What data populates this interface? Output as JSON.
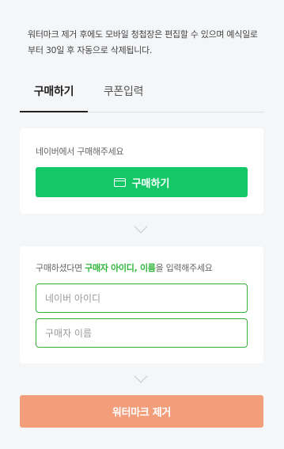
{
  "notice": "워터마크 제거 후에도 모바일 청첩장은 편집할 수 있으며 예식일로부터 30일 후 자동으로 삭제됩니다.",
  "tabs": [
    {
      "label": "구매하기",
      "active": true
    },
    {
      "label": "쿠폰입력",
      "active": false
    }
  ],
  "purchase": {
    "label": "네이버에서 구매해주세요",
    "button_label": "구매하기",
    "button_icon": "credit-card-icon",
    "button_color": "#14c867"
  },
  "verify": {
    "label_prefix": "구매하셨다면 ",
    "label_highlight": "구매자 아이디, 이름",
    "label_suffix": "을 입력해주세요",
    "highlight_color": "#2fb53a",
    "id_placeholder": "네이버 아이디",
    "id_value": "",
    "name_placeholder": "구매자 이름",
    "name_value": ""
  },
  "chevron_icon": "chevron-down-icon",
  "remove_button": {
    "label": "워터마크 제거",
    "color": "#f29e7b"
  }
}
